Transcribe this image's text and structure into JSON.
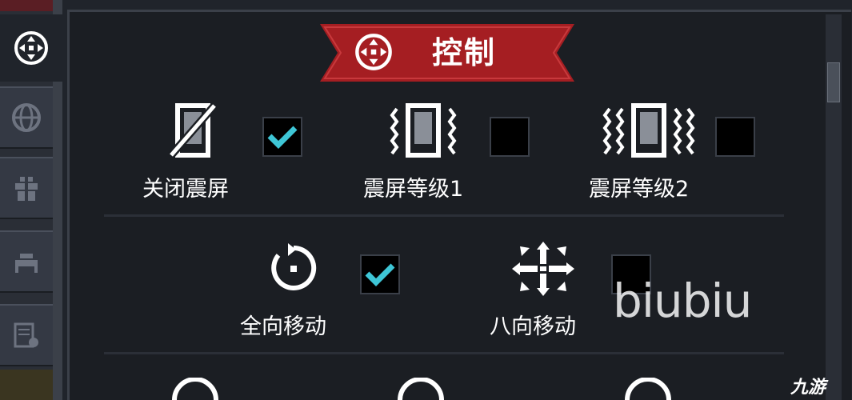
{
  "header": {
    "title": "控制",
    "icon": "dpad-icon"
  },
  "sidebar": {
    "tabs": [
      {
        "icon": "dpad-icon",
        "active": true
      },
      {
        "icon": "globe-icon",
        "active": false
      },
      {
        "icon": "gift-icon",
        "active": false
      },
      {
        "icon": "bed-icon",
        "active": false
      },
      {
        "icon": "settings-document-icon",
        "active": false
      }
    ]
  },
  "options": {
    "vibration_off": {
      "label": "关闭震屏",
      "checked": true,
      "icon": "vibration-off-icon"
    },
    "vibration_1": {
      "label": "震屏等级1",
      "checked": false,
      "icon": "vibration-level1-icon"
    },
    "vibration_2": {
      "label": "震屏等级2",
      "checked": false,
      "icon": "vibration-level2-icon"
    },
    "omni_move": {
      "label": "全向移动",
      "checked": true,
      "icon": "omnidirectional-icon"
    },
    "eight_move": {
      "label": "八向移动",
      "checked": false,
      "icon": "eight-direction-icon"
    }
  },
  "overlay": {
    "watermark": "biubiu",
    "logo": "九游"
  },
  "colors": {
    "banner": "#a51e22",
    "check": "#3ec6d6",
    "panel": "#1b1e23"
  }
}
